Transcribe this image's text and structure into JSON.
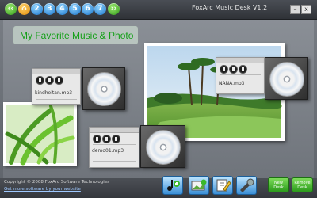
{
  "app": {
    "title": "FoxArc Music Desk V1.2"
  },
  "nav": {
    "back": "‹‹",
    "home": "",
    "pages": [
      "2",
      "3",
      "4",
      "5",
      "6",
      "7"
    ],
    "forward": "››"
  },
  "window_controls": {
    "minimize": "–",
    "close": "x"
  },
  "desk": {
    "heading": "My Favorite Music & Photo",
    "players": [
      {
        "filename": "kindheitan.mp3"
      },
      {
        "filename": "NANA.mp3"
      },
      {
        "filename": "demo01.mp3"
      }
    ]
  },
  "footer": {
    "copyright": "Copyright © 2008 FoxArc Software Technologies",
    "link": "Get more software by your website",
    "new_desk": "New\nDesk",
    "remove_desk": "Remove\nDesk"
  },
  "icons": [
    "add-music-icon",
    "add-photo-icon",
    "edit-note-icon",
    "settings-icon"
  ],
  "colors": {
    "accent_green": "#15a019",
    "title_text": "#e6e6e6"
  }
}
